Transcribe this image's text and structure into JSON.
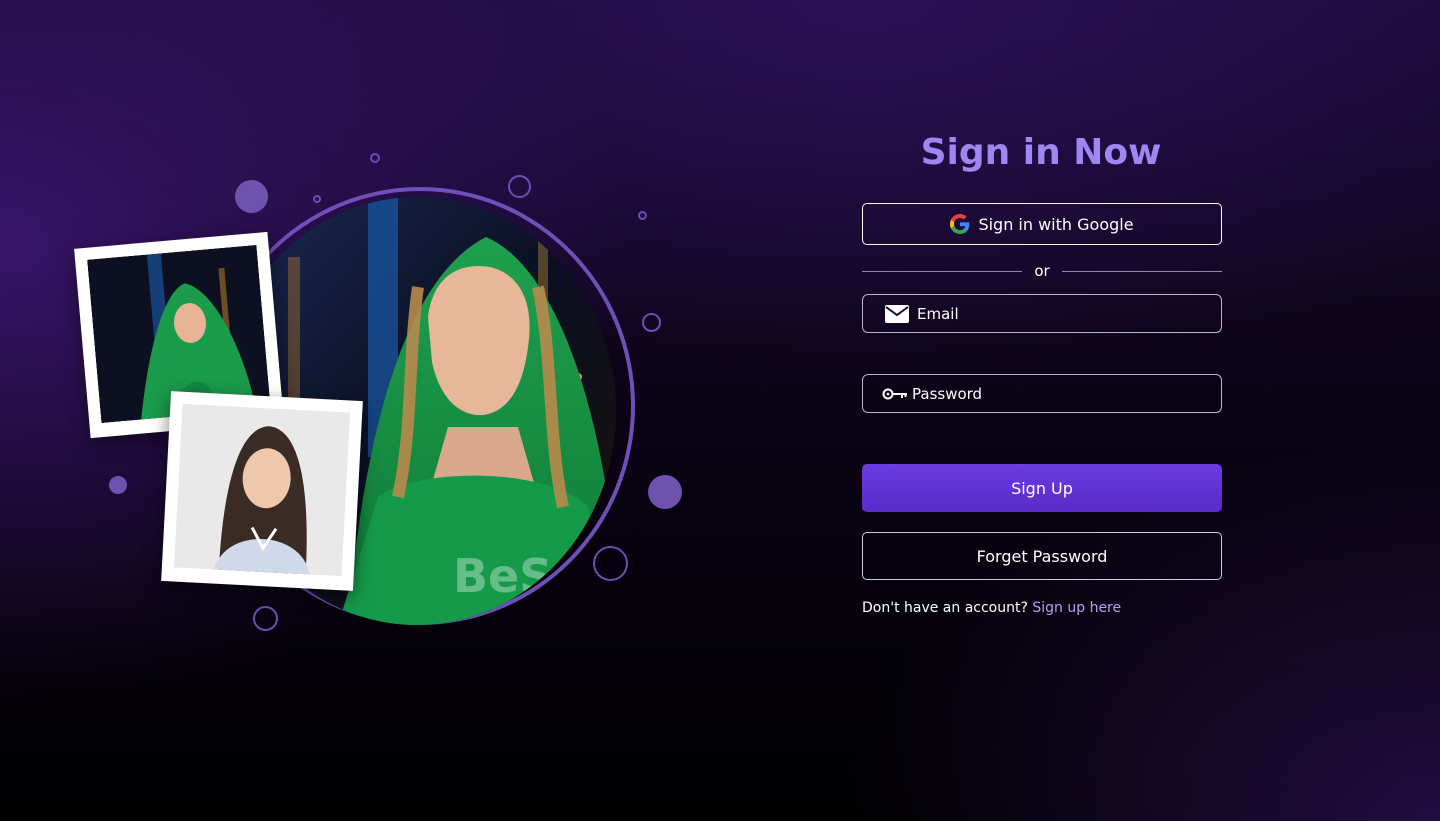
{
  "form": {
    "title": "Sign in Now",
    "google_label": "Sign in with Google",
    "divider_text": "or",
    "email_placeholder": "Email",
    "password_placeholder": "Password",
    "primary_label": "Sign Up",
    "secondary_label": "Forget Password",
    "signup_prompt": "Don't have an account?",
    "signup_link": "Sign up here"
  },
  "illustration": {
    "watermark_text": "BeS"
  },
  "icons": {
    "google": "google-icon",
    "email": "envelope-icon",
    "password": "key-icon"
  },
  "colors": {
    "accent": "#9f86f2",
    "primary_button": "#5f32d6",
    "link": "#b7a2f4",
    "ring": "#6f4fb8"
  }
}
